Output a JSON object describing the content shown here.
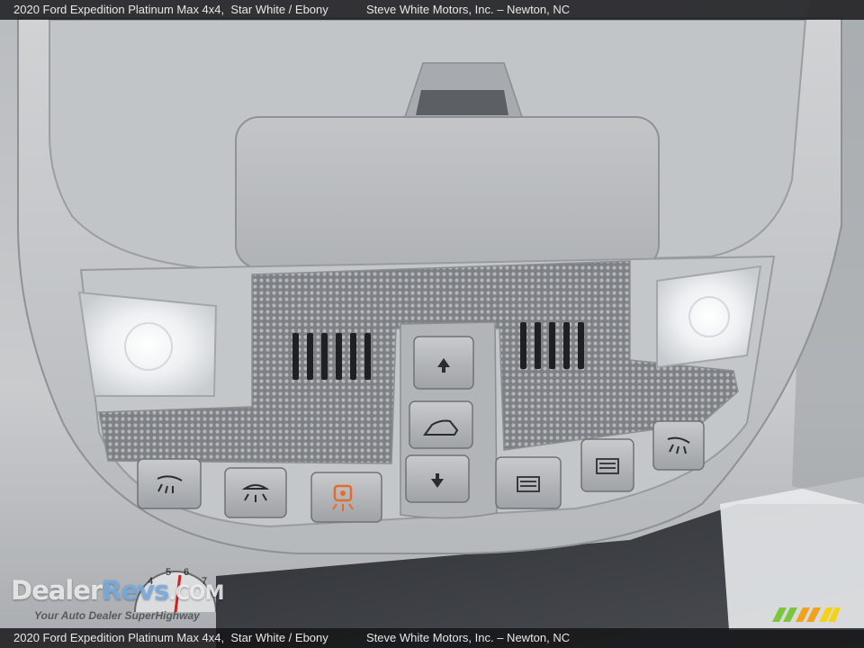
{
  "caption": {
    "vehicle": "2020 Ford Expedition Platinum Max 4x4,",
    "colors": "Star White / Ebony",
    "dealer": "Steve White Motors, Inc. – Newton, NC"
  },
  "watermark": {
    "brand": "DealerRevs",
    "brand_prefix": "Dealer",
    "brand_suffix": "Revs",
    "domain": ".COM",
    "tagline": "Your Auto Dealer SuperHighway",
    "gauge_numbers": [
      "4",
      "5",
      "6",
      "7"
    ]
  },
  "overhead_console": {
    "sunroof_buttons": [
      "arrow-up-icon",
      "sunroof-tilt-icon",
      "arrow-down-icon"
    ],
    "left_buttons": [
      "map-light-left-icon",
      "dome-light-icon",
      "sos-assist-icon"
    ],
    "right_buttons": [
      "garage-door-1-icon",
      "garage-door-2-icon",
      "map-light-right-icon"
    ],
    "accent_color": "#e86a2a"
  }
}
